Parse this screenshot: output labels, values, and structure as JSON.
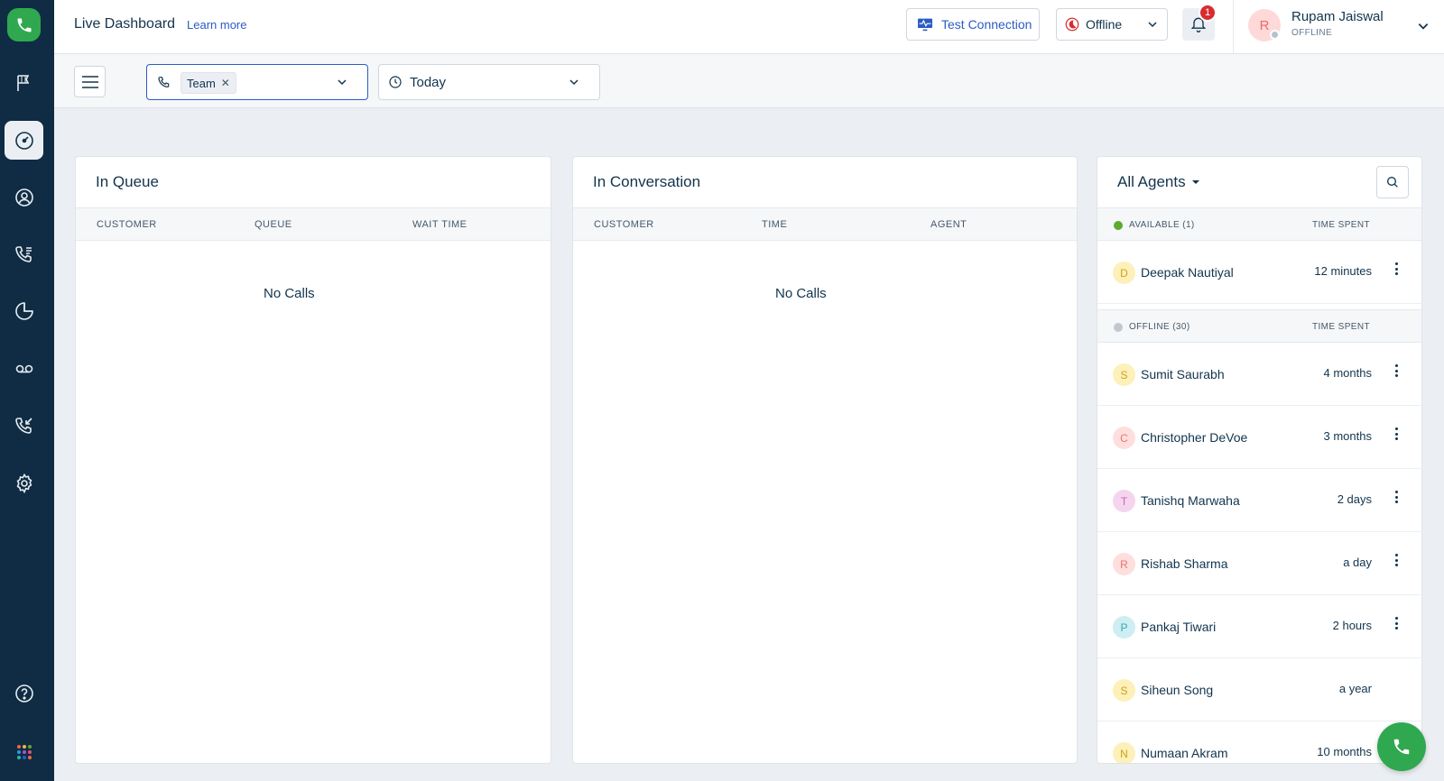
{
  "header": {
    "title": "Live Dashboard",
    "learn_more": "Learn more",
    "test_connection": "Test Connection",
    "status_value": "Offline",
    "notification_count": "1",
    "user": {
      "initial": "R",
      "name": "Rupam Jaiswal",
      "status": "OFFLINE"
    }
  },
  "filters": {
    "team_tag": "Team",
    "date_value": "Today"
  },
  "sidebar": {
    "items": [
      "flag-icon",
      "dashboard-icon",
      "contacts-icon",
      "call-log-icon",
      "reports-icon",
      "voicemail-icon",
      "callback-icon",
      "settings-icon",
      "help-icon",
      "apps-icon"
    ],
    "active": "dashboard-icon"
  },
  "in_queue": {
    "title": "In Queue",
    "columns": [
      "CUSTOMER",
      "QUEUE",
      "WAIT TIME"
    ],
    "empty": "No Calls"
  },
  "in_conversation": {
    "title": "In Conversation",
    "columns": [
      "CUSTOMER",
      "TIME",
      "AGENT"
    ],
    "empty": "No Calls"
  },
  "agents": {
    "title": "All Agents",
    "available": {
      "label": "AVAILABLE (1)",
      "time_header": "TIME SPENT",
      "color": "#5bab2d",
      "rows": [
        {
          "initial": "D",
          "name": "Deepak Nautiyal",
          "time": "12 minutes",
          "bg": "#fdf0b8",
          "fg": "#c9a31f"
        }
      ]
    },
    "offline": {
      "label": "OFFLINE (30)",
      "time_header": "TIME SPENT",
      "color": "#c2c8ce",
      "rows": [
        {
          "initial": "S",
          "name": "Sumit Saurabh",
          "time": "4 months",
          "bg": "#fdf0b8",
          "fg": "#c9a31f"
        },
        {
          "initial": "C",
          "name": "Christopher DeVoe",
          "time": "3 months",
          "bg": "#ffdede",
          "fg": "#e37676"
        },
        {
          "initial": "T",
          "name": "Tanishq Marwaha",
          "time": "2 days",
          "bg": "#f5d4ef",
          "fg": "#c46ab3"
        },
        {
          "initial": "R",
          "name": "Rishab Sharma",
          "time": "a day",
          "bg": "#ffdede",
          "fg": "#e37676"
        },
        {
          "initial": "P",
          "name": "Pankaj Tiwari",
          "time": "2 hours",
          "bg": "#cdeef2",
          "fg": "#3ea4b3"
        },
        {
          "initial": "S",
          "name": "Siheun Song",
          "time": "a year",
          "bg": "#fdf0b8",
          "fg": "#c9a31f"
        },
        {
          "initial": "N",
          "name": "Numaan Akram",
          "time": "10 months",
          "bg": "#fdf0b8",
          "fg": "#c9a31f"
        }
      ]
    }
  },
  "colors": {
    "brand_green": "#2fa84f",
    "sidebar_bg": "#0f2c44",
    "link_blue": "#2c5cc5",
    "badge_red": "#d72d30"
  }
}
